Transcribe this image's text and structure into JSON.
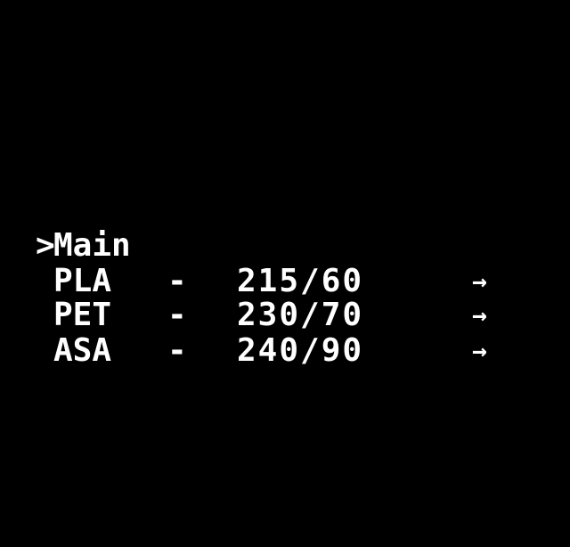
{
  "menu": {
    "cursor": ">",
    "title": "Main",
    "items": [
      {
        "name": "PLA",
        "separator": "-",
        "temp": "215/60",
        "arrow": "→"
      },
      {
        "name": "PET",
        "separator": "-",
        "temp": "230/70",
        "arrow": "→"
      },
      {
        "name": "ASA",
        "separator": "-",
        "temp": "240/90",
        "arrow": "→"
      }
    ]
  },
  "colors": {
    "background": "#000000",
    "foreground": "#ffffff"
  }
}
